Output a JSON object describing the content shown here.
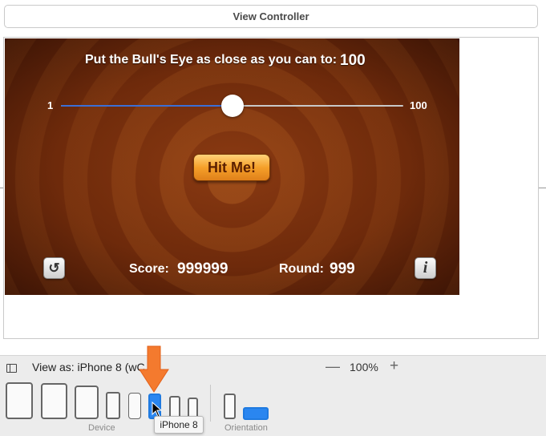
{
  "header": {
    "title": "View Controller"
  },
  "game": {
    "target_label": "Put the Bull's Eye as close as you can to:",
    "target_value": "100",
    "slider": {
      "min_label": "1",
      "max_label": "100",
      "value_fraction": 0.5
    },
    "hit_button_label": "Hit Me!",
    "start_over_icon": "undo-arrow-icon",
    "info_icon": "info-icon",
    "info_glyph": "i",
    "undo_glyph": "↺",
    "score_label": "Score:",
    "score_value": "999999",
    "round_label": "Round:",
    "round_value": "999"
  },
  "toolbar": {
    "view_as_label": "View as: iPhone 8 (wC",
    "zoom_minus": "—",
    "zoom_value": "100%",
    "zoom_plus": "+"
  },
  "device_bar": {
    "device_group_label": "Device",
    "orientation_group_label": "Orientation",
    "tooltip": "iPhone 8",
    "selected_color": "#2a86f0",
    "annotation_arrow_color": "#f47a2e"
  }
}
